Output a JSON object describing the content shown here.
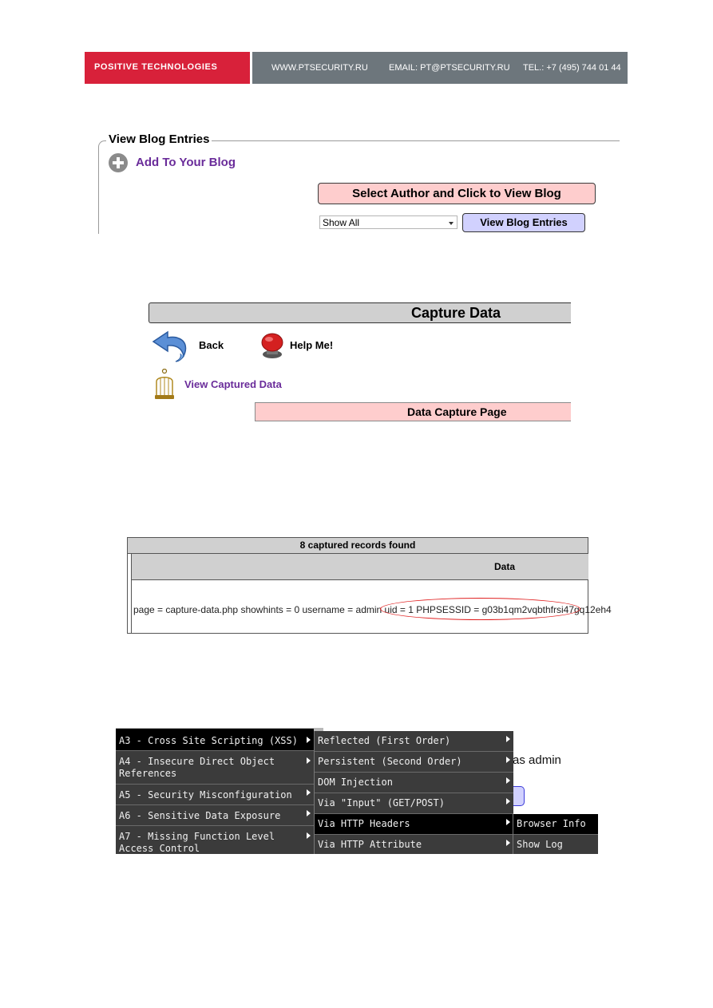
{
  "header": {
    "brand": "POSITIVE TECHNOLOGIES",
    "website": "WWW.PTSECURITY.RU",
    "email": "EMAIL: PT@PTSECURITY.RU",
    "phone": "TEL.: +7 (495) 744 01 44",
    "colors": {
      "brand_red": "#d8213a",
      "bar_gray": "#6d767c"
    }
  },
  "blog": {
    "legend": "View Blog Entries",
    "add_link": "Add To Your Blog",
    "add_icon": "plus-circle-icon",
    "banner": "Select Author and Click to View Blog",
    "author_select": {
      "selected": "Show All"
    },
    "view_button": "View Blog Entries"
  },
  "capture": {
    "title": "Capture Data",
    "back_label": "Back",
    "back_icon": "back-arrow-icon",
    "help_label": "Help Me!",
    "help_icon": "help-button-icon",
    "view_captured": "View Captured Data",
    "cage_icon": "birdcage-icon",
    "page_banner": "Data Capture Page"
  },
  "records": {
    "caption": "8 captured records found",
    "column": "Data",
    "row_text": "page = capture-data.php showhints = 0 username = admin uid = 1 PHPSESSID = g03b1qm2vqbthfrsi47gq12eh4",
    "highlight_color": "#e02020"
  },
  "menu": {
    "background_text": "as admin",
    "level1": [
      {
        "label": "A3 - Cross Site Scripting (XSS)",
        "selected": true
      },
      {
        "label": "A4 - Insecure Direct Object References"
      },
      {
        "label": "A5 - Security Misconfiguration"
      },
      {
        "label": "A6 - Sensitive Data Exposure"
      },
      {
        "label": "A7 - Missing Function Level Access Control"
      }
    ],
    "level2": [
      {
        "label": "Reflected (First Order)"
      },
      {
        "label": "Persistent (Second Order)"
      },
      {
        "label": "DOM Injection"
      },
      {
        "label": "Via \"Input\" (GET/POST)"
      },
      {
        "label": "Via HTTP Headers",
        "selected": true
      },
      {
        "label": "Via HTTP Attribute"
      }
    ],
    "level3": [
      {
        "label": "Browser Info",
        "selected": true
      },
      {
        "label": "Show Log"
      }
    ]
  }
}
